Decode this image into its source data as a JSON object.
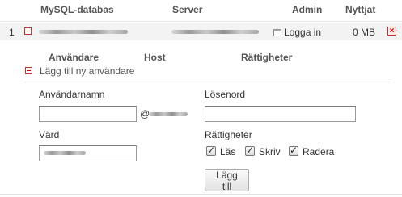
{
  "table": {
    "headers": {
      "database": "MySQL-databas",
      "server": "Server",
      "admin": "Admin",
      "used": "Nyttjat"
    },
    "row": {
      "index": "1",
      "login_label": "Logga in",
      "used_value": "0 MB"
    }
  },
  "users": {
    "headers": {
      "user": "Användare",
      "host": "Host",
      "rights": "Rättigheter"
    },
    "add_user_label": "Lägg till ny användare"
  },
  "form": {
    "username_label": "Användarnamn",
    "password_label": "Lösenord",
    "at_sign": "@",
    "host_label": "Värd",
    "rights_label": "Rättigheter",
    "perm_read": "Läs",
    "perm_write": "Skriv",
    "perm_delete": "Radera",
    "submit_label": "Lägg till"
  }
}
